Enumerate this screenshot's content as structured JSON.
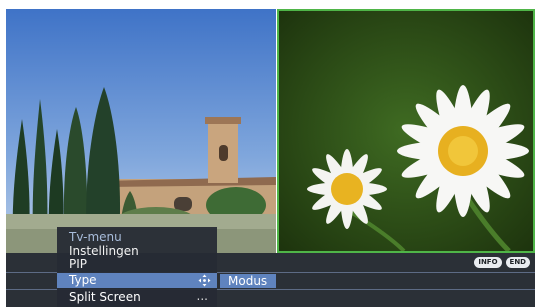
{
  "pip_view": {
    "left_picture": "landscape",
    "right_picture": "daisies",
    "active_border_color": "#4fb548"
  },
  "osd_badges": {
    "info": "INFO",
    "end": "END"
  },
  "menu": {
    "title": "Tv-menu",
    "items": [
      {
        "label": "Instellingen"
      },
      {
        "label": "PIP"
      },
      {
        "label": "Type",
        "selected": true,
        "icon": "move-arrows-icon"
      },
      {
        "label": "Split Screen",
        "suffix": "..."
      }
    ],
    "highlight_color": "#5f83be"
  },
  "submenu": {
    "label": "Modus"
  }
}
